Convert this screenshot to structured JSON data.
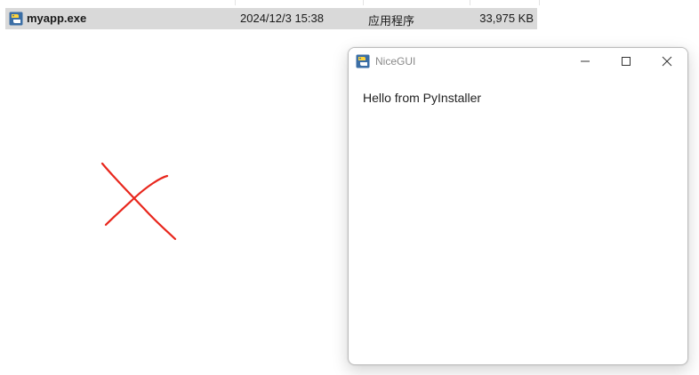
{
  "file_row": {
    "name": "myapp.exe",
    "date_modified": "2024/12/3 15:38",
    "type": "应用程序",
    "size": "33,975 KB",
    "icon": "python-app-icon",
    "selected": true
  },
  "annotation": {
    "icon": "red-x-mark",
    "color": "#e8271d"
  },
  "window": {
    "title": "NiceGUI",
    "icon": "python-app-icon",
    "controls": {
      "minimize": "minimize-icon",
      "maximize": "maximize-icon",
      "close": "close-icon"
    },
    "body_text": "Hello from PyInstaller"
  },
  "colors": {
    "selection": "#d9d9d9",
    "title_text": "#8a8a8a"
  }
}
